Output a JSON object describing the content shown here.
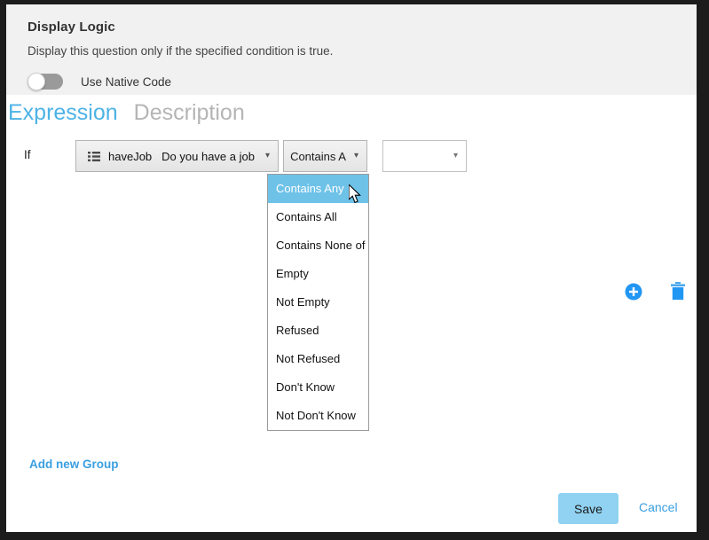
{
  "header": {
    "title": "Display Logic",
    "subtitle": "Display this question only if the specified condition is true.",
    "native_code_toggle_label": "Use Native Code",
    "native_code_toggle_state": "off"
  },
  "tabs": [
    {
      "label": "Expression",
      "active": true
    },
    {
      "label": "Description",
      "active": false
    }
  ],
  "condition": {
    "if_label": "If",
    "question_select": {
      "icon": "list-icon",
      "code": "haveJob",
      "text": "Do you have a job",
      "caret": "chevron-down-icon"
    },
    "operator_select": {
      "value": "Contains A",
      "caret": "chevron-down-icon"
    },
    "value_select": {
      "value": "",
      "caret": "chevron-down-icon"
    },
    "add_icon": "plus-circle-icon",
    "delete_icon": "trash-icon"
  },
  "operator_menu": {
    "open": true,
    "selected_index": 0,
    "options": [
      "Contains Any",
      "Contains All",
      "Contains None of",
      "Empty",
      "Not Empty",
      "Refused",
      "Not Refused",
      "Don't Know",
      "Not Don't Know"
    ]
  },
  "footer": {
    "add_group_label": "Add new Group",
    "save_label": "Save",
    "cancel_label": "Cancel"
  },
  "colors": {
    "accent_blue": "#3a9fe0",
    "tab_active": "#4db3e6",
    "tab_inactive": "#b5b5b5",
    "menu_highlight": "#6ec2e8",
    "save_button_bg": "#91d2f2",
    "header_bg": "#f1f1f1",
    "icon_blue": "#2196f3"
  }
}
